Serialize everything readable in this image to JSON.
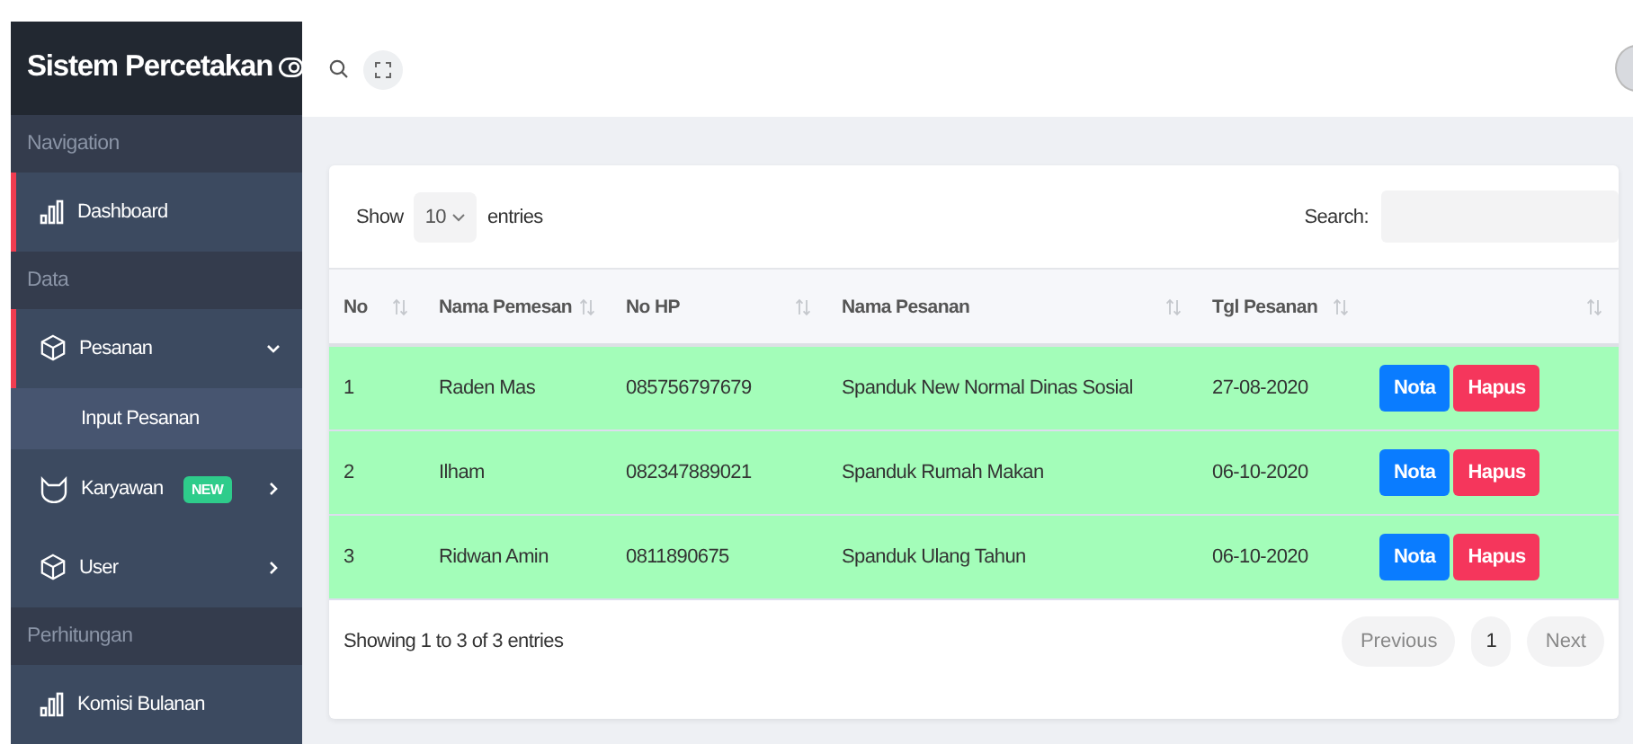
{
  "sidebar": {
    "brand": "Sistem Percetakan",
    "items": [
      {
        "kind": "section",
        "label": "Navigation"
      },
      {
        "kind": "item",
        "label": "Dashboard",
        "active": true
      },
      {
        "kind": "section",
        "label": "Data"
      },
      {
        "kind": "item",
        "label": "Pesanan",
        "active": true,
        "expanded": true
      },
      {
        "kind": "subitem",
        "label": "Input Pesanan"
      },
      {
        "kind": "item",
        "label": "Karyawan",
        "active": false,
        "expanded": false,
        "badge": "NEW"
      },
      {
        "kind": "item",
        "label": "User",
        "active": false,
        "expanded": false
      },
      {
        "kind": "section",
        "label": "Perhitungan"
      },
      {
        "kind": "item",
        "label": "Komisi Bulanan",
        "active": false
      }
    ]
  },
  "table_panel": {
    "length_label_before": "Show",
    "length_value": "10",
    "length_label_after": "entries",
    "search_label": "Search:",
    "columns": [
      "No",
      "Nama Pemesan",
      "No HP",
      "Nama Pesanan",
      "Tgl Pesanan"
    ],
    "rows": [
      {
        "no": "1",
        "nama_pemesan": "Raden Mas",
        "no_hp": "085756797679",
        "nama_pesanan": "Spanduk New Normal Dinas Sosial",
        "tgl_pesanan": "27-08-2020",
        "actions": [
          "Nota",
          "Hapus"
        ]
      },
      {
        "no": "2",
        "nama_pemesan": "Ilham",
        "no_hp": "082347889021",
        "nama_pesanan": "Spanduk Rumah Makan",
        "tgl_pesanan": "06-10-2020",
        "actions": [
          "Nota",
          "Hapus"
        ]
      },
      {
        "no": "3",
        "nama_pemesan": "Ridwan Amin",
        "no_hp": "0811890675",
        "nama_pesanan": "Spanduk Ulang Tahun",
        "tgl_pesanan": "06-10-2020",
        "actions": [
          "Nota",
          "Hapus"
        ]
      }
    ],
    "info": "Showing 1 to 3 of 3 entries",
    "pagination": [
      {
        "label": "Previous",
        "kind": "nav"
      },
      {
        "label": "1",
        "kind": "page",
        "selected": true
      },
      {
        "label": "Next",
        "kind": "nav"
      }
    ]
  }
}
